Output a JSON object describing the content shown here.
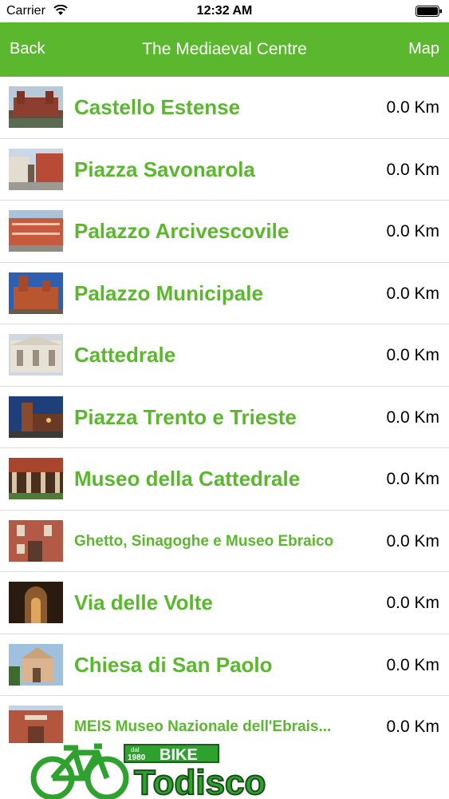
{
  "status": {
    "carrier": "Carrier",
    "time": "12:32 AM"
  },
  "nav": {
    "back": "Back",
    "title": "The Mediaeval Centre",
    "map": "Map"
  },
  "colors": {
    "accent": "#5bb82e",
    "logo_green": "#2fa12e"
  },
  "items": [
    {
      "name": "Castello Estense",
      "distance": "0.0 Km"
    },
    {
      "name": "Piazza Savonarola",
      "distance": "0.0 Km"
    },
    {
      "name": "Palazzo Arcivescovile",
      "distance": "0.0 Km"
    },
    {
      "name": "Palazzo Municipale",
      "distance": "0.0 Km"
    },
    {
      "name": "Cattedrale",
      "distance": "0.0 Km"
    },
    {
      "name": "Piazza Trento e Trieste",
      "distance": "0.0 Km"
    },
    {
      "name": "Museo della Cattedrale",
      "distance": "0.0 Km"
    },
    {
      "name": "Ghetto, Sinagoghe e Museo Ebraico",
      "distance": "0.0 Km"
    },
    {
      "name": "Via delle Volte",
      "distance": "0.0 Km"
    },
    {
      "name": "Chiesa di San Paolo",
      "distance": "0.0 Km"
    },
    {
      "name": "MEIS Museo Nazionale dell'Ebrais...",
      "distance": "0.0 Km"
    }
  ],
  "brand": {
    "tag_small": "dal",
    "year": "1980",
    "word_bike": "BIKE",
    "word_name": "Todisco"
  }
}
